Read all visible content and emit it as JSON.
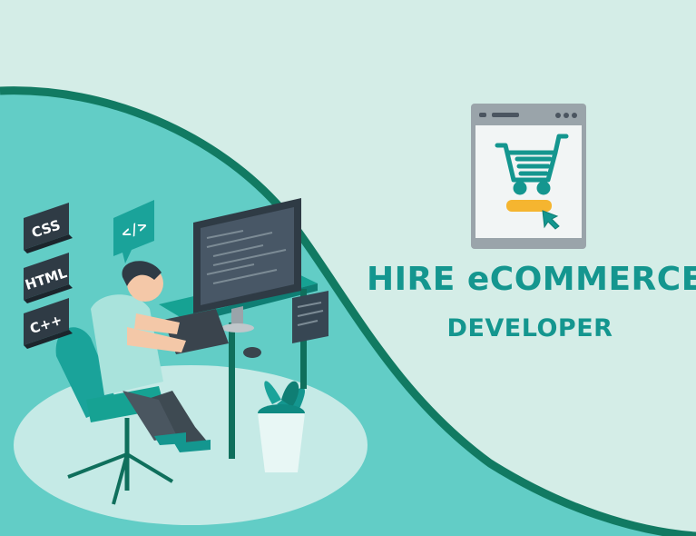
{
  "banner": {
    "title": "HIRE eCOMMERCE",
    "subtitle": "DEVELOPER"
  },
  "tech_badges": [
    "CSS",
    "HTML",
    "C++"
  ],
  "code_bubble": "</>",
  "icons": [
    "shopping-cart-icon",
    "cursor-icon",
    "code-tag-icon",
    "plant-icon"
  ],
  "colors": {
    "background": "#d4ede7",
    "accent_teal": "#14968f",
    "wave_dark": "#117a62",
    "wave_light": "#62cdc6",
    "button_yellow": "#f5b530"
  }
}
